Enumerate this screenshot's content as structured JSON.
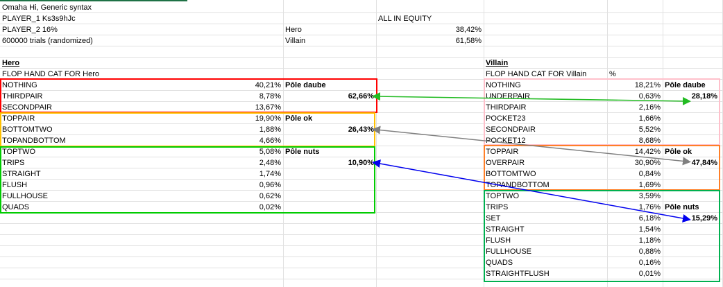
{
  "header": {
    "title": "Omaha Hi, Generic syntax",
    "player1": "PLAYER_1 Ks3s9hJc",
    "player2": "PLAYER_2 16%",
    "trials": "600000 trials (randomized)",
    "equity_title": "ALL IN EQUITY",
    "hero_label": "Hero",
    "hero_equity": "38,42%",
    "villain_label": "Villain",
    "villain_equity": "61,58%"
  },
  "hero": {
    "title": "Hero",
    "subtitle": "FLOP HAND CAT FOR Hero",
    "rows": [
      {
        "name": "NOTHING",
        "pct": "40,21%"
      },
      {
        "name": "THIRDPAIR",
        "pct": "8,78%"
      },
      {
        "name": "SECONDPAIR",
        "pct": "13,67%"
      },
      {
        "name": "TOPPAIR",
        "pct": "19,90%"
      },
      {
        "name": "BOTTOMTWO",
        "pct": "1,88%"
      },
      {
        "name": "TOPANDBOTTOM",
        "pct": "4,66%"
      },
      {
        "name": "TOPTWO",
        "pct": "5,08%"
      },
      {
        "name": "TRIPS",
        "pct": "2,48%"
      },
      {
        "name": "STRAIGHT",
        "pct": "1,74%"
      },
      {
        "name": "FLUSH",
        "pct": "0,96%"
      },
      {
        "name": "FULLHOUSE",
        "pct": "0,62%"
      },
      {
        "name": "QUADS",
        "pct": "0,02%"
      }
    ],
    "poles": [
      {
        "label": "Pôle daube",
        "total": "62,66%"
      },
      {
        "label": "Pôle ok",
        "total": "26,43%"
      },
      {
        "label": "Pôle nuts",
        "total": "10,90%"
      }
    ]
  },
  "villain": {
    "title": "Villain",
    "subtitle": "FLOP HAND CAT FOR Villain",
    "pct_header": "%",
    "rows": [
      {
        "name": "NOTHING",
        "pct": "18,21%"
      },
      {
        "name": "UNDERPAIR",
        "pct": "0,63%"
      },
      {
        "name": "THIRDPAIR",
        "pct": "2,16%"
      },
      {
        "name": "POCKET23",
        "pct": "1,66%"
      },
      {
        "name": "SECONDPAIR",
        "pct": "5,52%"
      },
      {
        "name": "POCKET12",
        "pct": "8,68%"
      },
      {
        "name": "TOPPAIR",
        "pct": "14,42%"
      },
      {
        "name": "OVERPAIR",
        "pct": "30,90%"
      },
      {
        "name": "BOTTOMTWO",
        "pct": "0,84%"
      },
      {
        "name": "TOPANDBOTTOM",
        "pct": "1,69%"
      },
      {
        "name": "TOPTWO",
        "pct": "3,59%"
      },
      {
        "name": "TRIPS",
        "pct": "1,76%"
      },
      {
        "name": "SET",
        "pct": "6,18%"
      },
      {
        "name": "STRAIGHT",
        "pct": "1,54%"
      },
      {
        "name": "FLUSH",
        "pct": "1,18%"
      },
      {
        "name": "FULLHOUSE",
        "pct": "0,88%"
      },
      {
        "name": "QUADS",
        "pct": "0,16%"
      },
      {
        "name": "STRAIGHTFLUSH",
        "pct": "0,01%"
      }
    ],
    "poles": [
      {
        "label": "Pôle daube",
        "total": "28,18%"
      },
      {
        "label": "Pôle ok",
        "total": "47,84%"
      },
      {
        "label": "Pôle nuts",
        "total": "15,29%"
      }
    ]
  },
  "colors": {
    "daube_hero": "#ff0000",
    "ok_hero": "#ffc000",
    "nuts_hero": "#00cc00",
    "daube_villain": "#ffc0cb",
    "ok_villain": "#ff7f27",
    "nuts_villain": "#00b050",
    "arrow_green": "#22bb22",
    "arrow_grey": "#808080",
    "arrow_blue": "#0000ee"
  }
}
